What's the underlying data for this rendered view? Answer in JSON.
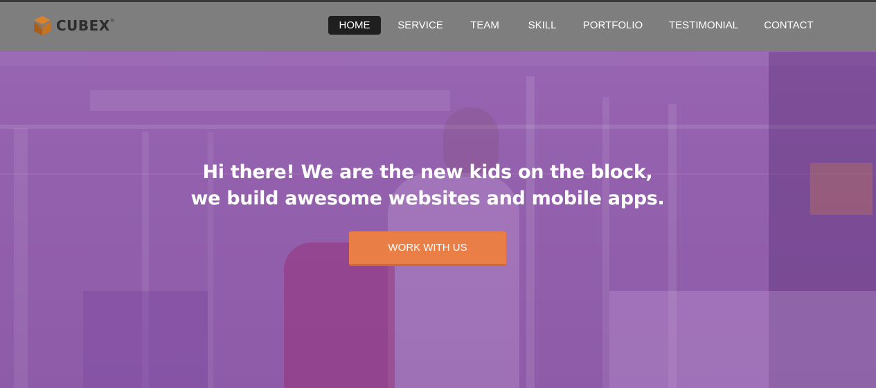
{
  "brand": {
    "name": "CUBEX",
    "reg_mark": "®",
    "logo_color": "#c8731f"
  },
  "nav": {
    "items": [
      {
        "label": "HOME",
        "active": true
      },
      {
        "label": "SERVICE",
        "active": false
      },
      {
        "label": "TEAM",
        "active": false
      },
      {
        "label": "SKILL",
        "active": false
      },
      {
        "label": "PORTFOLIO",
        "active": false
      },
      {
        "label": "TESTIMONIAL",
        "active": false
      },
      {
        "label": "CONTACT",
        "active": false
      }
    ]
  },
  "hero": {
    "line1": "Hi there! We are the new kids on the block,",
    "line2": "we build awesome websites and mobile apps.",
    "cta_label": "WORK WITH US",
    "overlay_color": "#9461ae",
    "cta_color": "#ea7e47"
  }
}
